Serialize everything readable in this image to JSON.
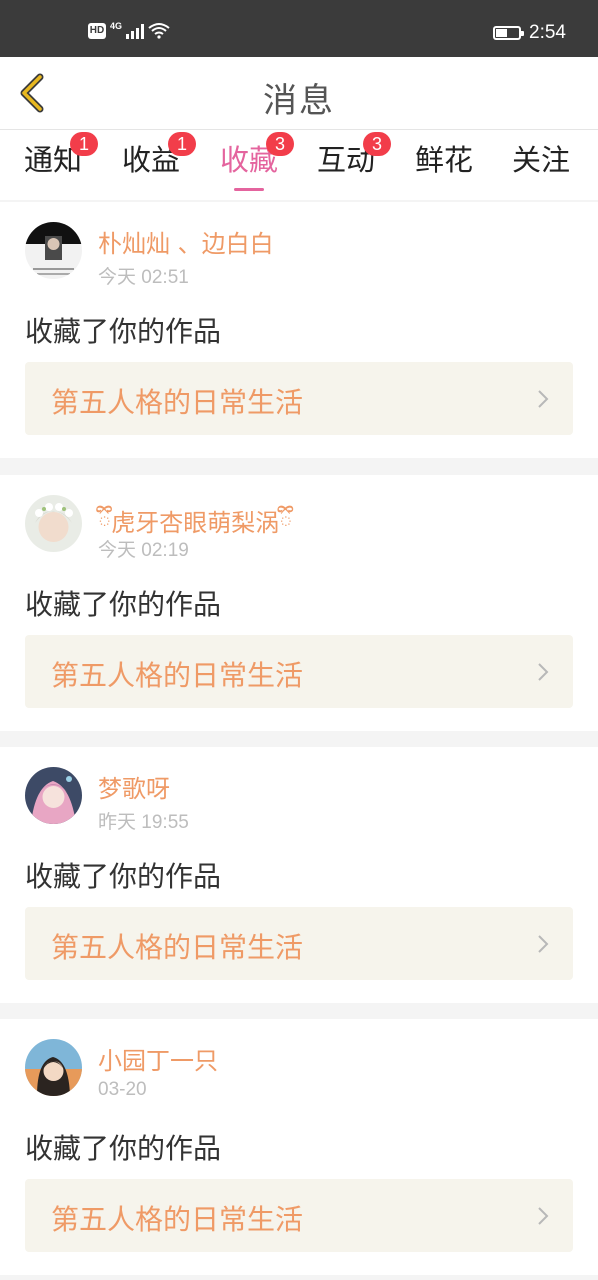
{
  "status_bar": {
    "hd": "HD",
    "network": "4G",
    "time": "2:54",
    "battery_level": 0.5
  },
  "header": {
    "title": "消息",
    "back_icon": "chevron-left-icon"
  },
  "tabs": [
    {
      "label": "通知",
      "badge": "1",
      "active": false
    },
    {
      "label": "收益",
      "badge": "1",
      "active": false
    },
    {
      "label": "收藏",
      "badge": "3",
      "active": true
    },
    {
      "label": "互动",
      "badge": "3",
      "active": false
    },
    {
      "label": "鲜花",
      "badge": null,
      "active": false
    },
    {
      "label": "关注",
      "badge": null,
      "active": false
    }
  ],
  "messages": [
    {
      "user": "朴灿灿 、边白白",
      "time": "今天 02:51",
      "action": "收藏了你的作品",
      "work": "第五人格的日常生活"
    },
    {
      "user": "ྀི虎牙杏眼萌梨涡ྀི",
      "time": "今天 02:19",
      "action": "收藏了你的作品",
      "work": "第五人格的日常生活"
    },
    {
      "user": "梦歌呀",
      "time": "昨天 19:55",
      "action": "收藏了你的作品",
      "work": "第五人格的日常生活"
    },
    {
      "user": "小园丁一只",
      "time": "03-20",
      "action": "收藏了你的作品",
      "work": "第五人格的日常生活"
    }
  ],
  "colors": {
    "accent_pink": "#e4649e",
    "name_orange": "#ef9a66",
    "badge_red": "#f23d4a",
    "back_yellow": "#e8b820"
  }
}
